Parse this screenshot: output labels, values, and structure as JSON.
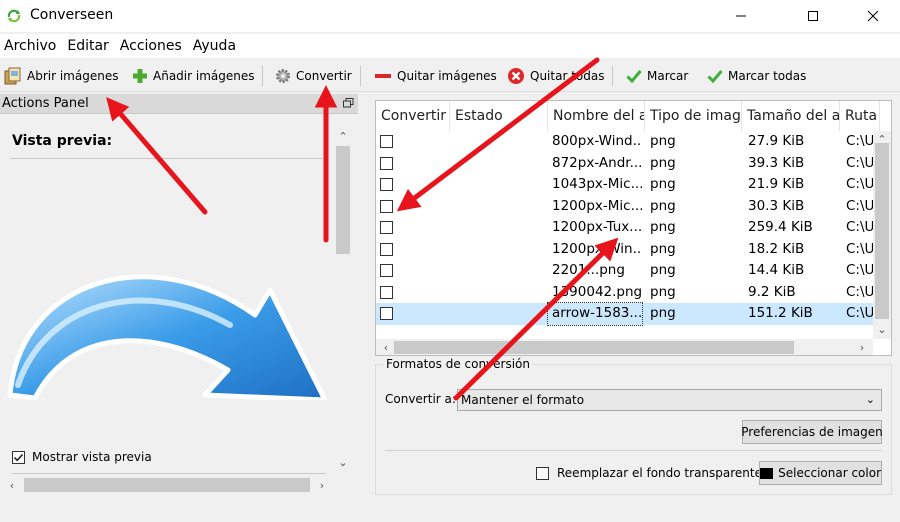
{
  "window": {
    "title": "Converseen",
    "app_icon": "converseen-logo-icon",
    "controls": [
      "minimize-icon",
      "maximize-icon",
      "close-icon"
    ]
  },
  "menu": {
    "items": [
      {
        "label": "Archivo",
        "accel": "A",
        "rest": "rchivo"
      },
      {
        "label": "Editar",
        "accel": "E",
        "rest": "ditar"
      },
      {
        "label": "Acciones",
        "accel": "A",
        "rest": "cciones"
      },
      {
        "label": "Ayuda",
        "accel": "",
        "rest": "Ayuda"
      }
    ]
  },
  "toolbar": {
    "open_label": "Abrir imágenes",
    "add_label": "Añadir imágenes",
    "convert_label": "Convertir",
    "remove_label": "Quitar imágenes",
    "remove_all_label": "Quitar todas",
    "check_label": "Marcar",
    "check_all_label": "Marcar todas"
  },
  "actions_panel": {
    "title": "Actions Panel",
    "preview_title": "Vista previa:",
    "show_preview_label": "Mostrar vista previa",
    "show_preview_checked": true
  },
  "table": {
    "columns": [
      "Convertir",
      "Estado",
      "Nombre del a",
      "Tipo de imag",
      "Tamaño del a",
      "Ruta"
    ],
    "rows": [
      {
        "checked": false,
        "status": "",
        "name": "800px-Wind...",
        "type": "png",
        "size": "27.9 KiB",
        "path": "C:\\U"
      },
      {
        "checked": false,
        "status": "",
        "name": "872px-Andr...",
        "type": "png",
        "size": "39.3 KiB",
        "path": "C:\\U"
      },
      {
        "checked": false,
        "status": "",
        "name": "1043px-Mic...",
        "type": "png",
        "size": "21.9 KiB",
        "path": "C:\\U"
      },
      {
        "checked": false,
        "status": "",
        "name": "1200px-Mic...",
        "type": "png",
        "size": "30.3 KiB",
        "path": "C:\\U"
      },
      {
        "checked": false,
        "status": "",
        "name": "1200px-Tux....",
        "type": "png",
        "size": "259.4 KiB",
        "path": "C:\\U"
      },
      {
        "checked": false,
        "status": "",
        "name": "1200px-Win...",
        "type": "png",
        "size": "18.2 KiB",
        "path": "C:\\U"
      },
      {
        "checked": false,
        "status": "",
        "name": "2201...png",
        "type": "png",
        "size": "14.4 KiB",
        "path": "C:\\U"
      },
      {
        "checked": false,
        "status": "",
        "name": "1390042.png",
        "type": "png",
        "size": "9.2 KiB",
        "path": "C:\\U"
      },
      {
        "checked": false,
        "status": "",
        "name": "arrow-1583...",
        "type": "png",
        "size": "151.2 KiB",
        "path": "C:\\U",
        "selected": true
      }
    ]
  },
  "formats": {
    "group_title": "Formatos de conversión",
    "convert_to_label": "Convertir a:",
    "convert_to_value": "Mantener el formato",
    "image_prefs_label": "Preferencias de imagen",
    "replace_transparent_label": "Reemplazar el fondo transparente",
    "replace_transparent_checked": false,
    "select_color_label": "Seleccionar color",
    "selected_color": "#000000"
  },
  "colors": {
    "annotation_red": "#e8141c",
    "selection_blue": "#cce8ff",
    "preview_arrow_blue": "#3a9ce8"
  }
}
